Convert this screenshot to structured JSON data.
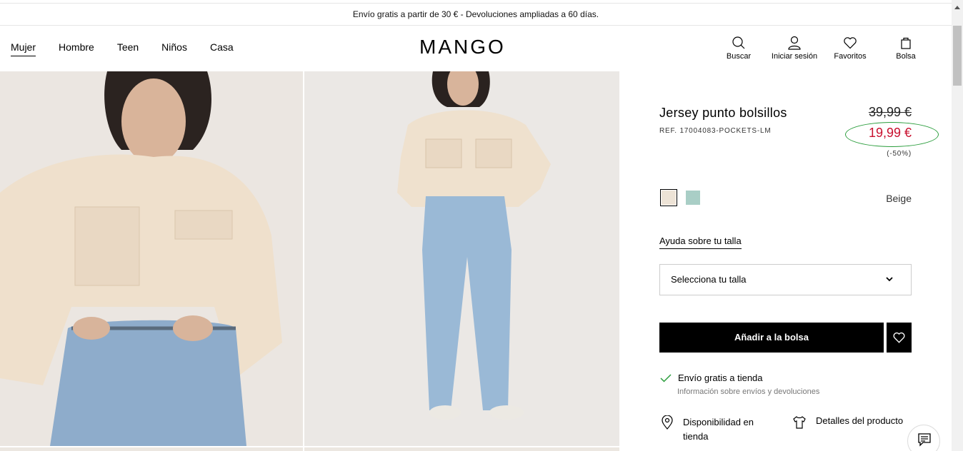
{
  "promo_bar": {
    "text": "Envío gratis a partir de 30 € - Devoluciones ampliadas a 60 días."
  },
  "header": {
    "nav": [
      {
        "label": "Mujer",
        "active": true
      },
      {
        "label": "Hombre"
      },
      {
        "label": "Teen"
      },
      {
        "label": "Niños"
      },
      {
        "label": "Casa"
      }
    ],
    "logo": "MANGO",
    "actions": [
      {
        "label": "Buscar",
        "icon": "search-icon"
      },
      {
        "label": "Iniciar sesión",
        "icon": "user-icon"
      },
      {
        "label": "Favoritos",
        "icon": "heart-icon"
      },
      {
        "label": "Bolsa",
        "icon": "bag-icon"
      }
    ]
  },
  "product": {
    "title": "Jersey punto bolsillos",
    "ref": "REF. 17004083-POCKETS-LM",
    "old_price": "39,99 €",
    "new_price": "19,99 €",
    "discount": "(-50%)",
    "colors": [
      {
        "name": "Beige",
        "hex": "#ede3d6",
        "selected": true
      },
      {
        "name": "mint",
        "hex": "#a9cec6"
      }
    ],
    "selected_color": "Beige",
    "size_help": "Ayuda sobre tu talla",
    "size_placeholder": "Selecciona tu talla",
    "add_to_bag": "Añadir a la bolsa",
    "shipping_title": "Envío gratis a tienda",
    "shipping_info": "Información sobre envíos y devoluciones",
    "availability": "Disponibilidad en tienda",
    "details": "Detalles del producto"
  },
  "colors": {
    "sale": "#c8102e",
    "annotation": "#2a9d3c",
    "check": "#2a9d3c"
  }
}
